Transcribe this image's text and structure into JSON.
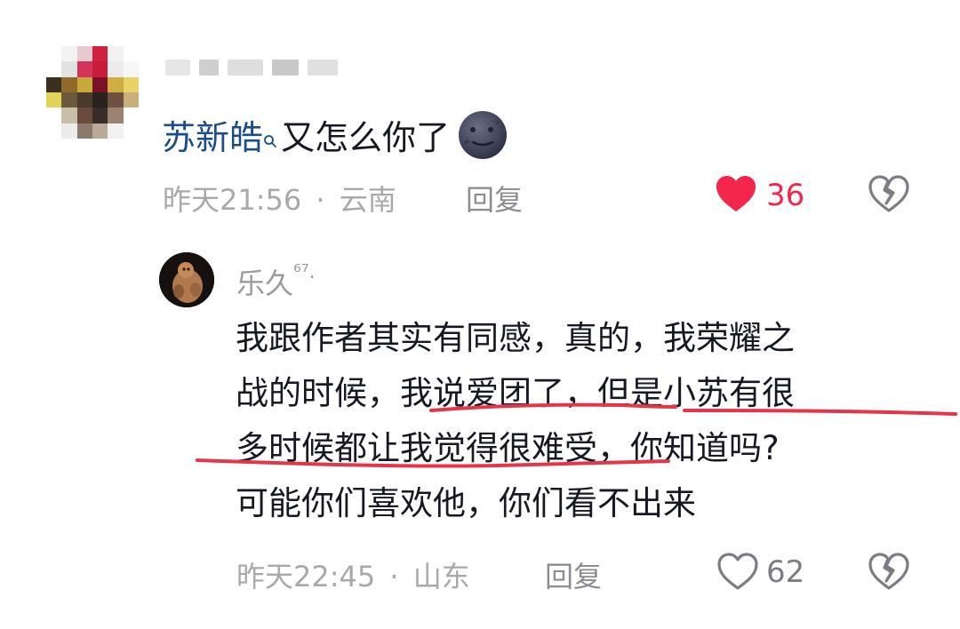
{
  "comment": {
    "mention": "苏新皓",
    "text": "又怎么你了",
    "time": "昨天21:56",
    "separator": "·",
    "location": "云南",
    "reply_label": "回复",
    "likes": "36",
    "liked": true
  },
  "reply": {
    "username": "乐久",
    "username_suffix": "⁶⁷.",
    "lines": [
      "我跟作者其实有同感，真的，我荣耀之",
      "战的时候，我说爱团了，但是小苏有很",
      "多时候都让我觉得很难受，你知道吗?",
      "可能你们喜欢他，你们看不出来"
    ],
    "time": "昨天22:45",
    "separator": "·",
    "location": "山东",
    "reply_label": "回复",
    "likes": "62",
    "liked": false
  },
  "colors": {
    "like_active": "#f2274b",
    "mention": "#1b4d8a",
    "annotation_red": "#e53649"
  },
  "icons": {
    "like": "heart-icon",
    "dislike": "broken-heart-icon",
    "mention_marker": "search-icon",
    "emoji": "new-moon-face-emoji"
  }
}
